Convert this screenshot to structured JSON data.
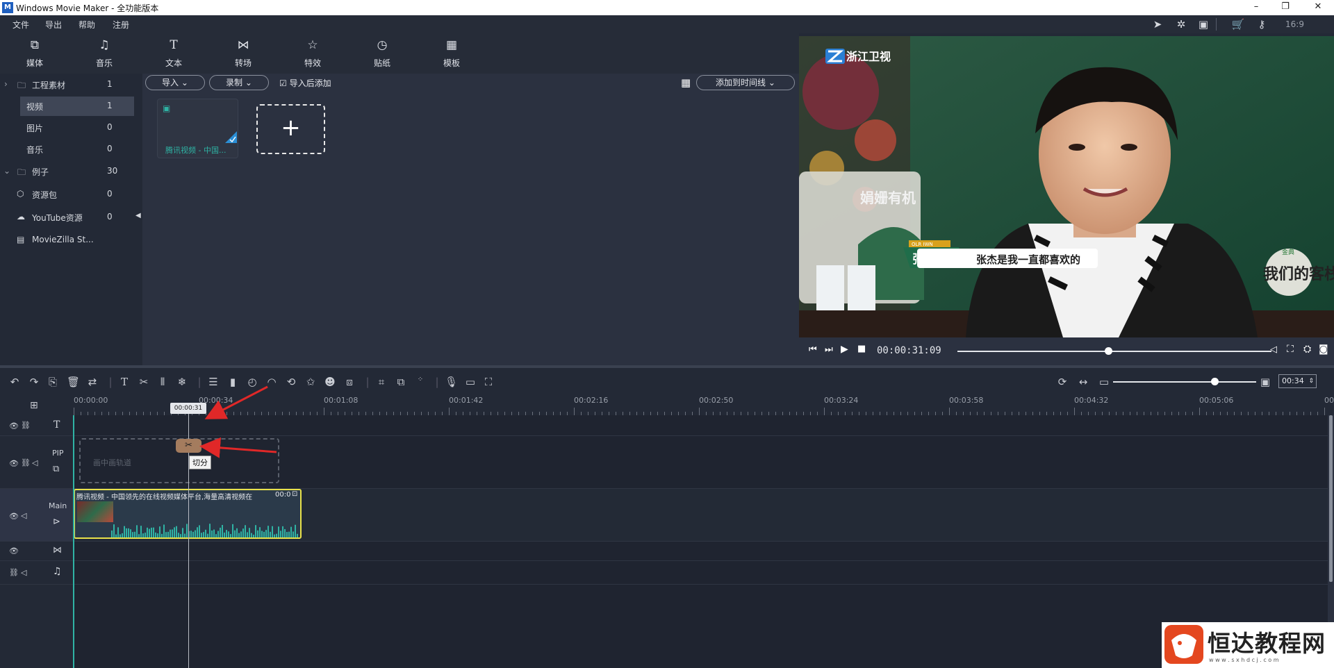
{
  "window": {
    "title": "Windows Movie Maker  - 全功能版本",
    "logo": "M",
    "minimize": "–",
    "restore": "❐",
    "close": "✕"
  },
  "menu": [
    "文件",
    "导出",
    "帮助",
    "注册"
  ],
  "top_right_icons": [
    "pin-icon",
    "settings-star-icon",
    "save-icon",
    "cart-icon",
    "key-icon",
    "aspect-icon"
  ],
  "aspect_label": "16:9",
  "tabs": [
    {
      "icon": "media-icon",
      "label": "媒体"
    },
    {
      "icon": "music-icon",
      "label": "音乐"
    },
    {
      "icon": "text-icon",
      "label": "文本"
    },
    {
      "icon": "transition-icon",
      "label": "转场"
    },
    {
      "icon": "effects-icon",
      "label": "特效"
    },
    {
      "icon": "sticker-icon",
      "label": "贴纸"
    },
    {
      "icon": "template-icon",
      "label": "模板"
    }
  ],
  "tree": [
    {
      "label": "工程素材",
      "count": "1"
    },
    {
      "label": "视频",
      "count": "1"
    },
    {
      "label": "图片",
      "count": "0"
    },
    {
      "label": "音乐",
      "count": "0"
    },
    {
      "label": "例子",
      "count": "30"
    },
    {
      "label": "资源包",
      "count": "0"
    },
    {
      "label": "YouTube资源",
      "count": "0"
    },
    {
      "label": "MovieZilla St...",
      "count": ""
    }
  ],
  "media_toolbar": {
    "import": "导入",
    "record": "录制",
    "add_after_import": "导入后添加",
    "add_to_timeline": "添加到时间线"
  },
  "media_items": [
    {
      "title": "腾讯视频 - 中国..."
    }
  ],
  "preview": {
    "channel_logo": "浙江卫视",
    "caption_name": "张凯丽",
    "caption_text": "张杰是我一直都喜欢的",
    "caption_tag": "OLR IWN",
    "show_logo": "我们的客栈",
    "show_logo_sub": "金典",
    "bottle_text": "娟姗有机",
    "timecode": "00:00:31:09",
    "seek_progress": 0.48
  },
  "timeline_toolbar": {
    "zoom_progress": 0.71,
    "duration": "00:34"
  },
  "ruler": {
    "labels": [
      "00:00:00",
      "00:00:34",
      "00:01:08",
      "00:01:42",
      "00:02:16",
      "00:02:50",
      "00:03:24",
      "00:03:58",
      "00:04:32",
      "00:05:06",
      "00"
    ],
    "playhead_time": "00:00:31"
  },
  "tracks": {
    "pip_label": "PIP",
    "pip_placeholder": "画中画轨道",
    "split_tooltip": "切分",
    "main_label": "Main",
    "clip_title": "腾讯视频 - 中国领先的在线视频媒体平台,海量高清视频在",
    "clip_time": "00:0"
  },
  "watermark": {
    "title": "恒达教程网",
    "url": "w w w . s x h d c j . c o m"
  },
  "colors": {
    "accent_teal": "#2fb3a4",
    "clip_border": "#e9e24a",
    "annotation_arrow": "#e02828"
  }
}
